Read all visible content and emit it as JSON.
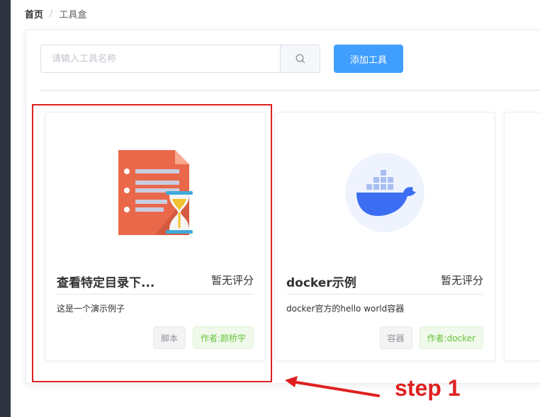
{
  "breadcrumb": {
    "home": "首页",
    "separator": "/",
    "current": "工具盒"
  },
  "search": {
    "placeholder": "请输入工具名称",
    "value": ""
  },
  "add_button": "添加工具",
  "cards": [
    {
      "title": "查看特定目录下...",
      "rating": "暂无评分",
      "description": "这是一个演示例子",
      "tags": [
        "脚本",
        "作者:颜桥宇"
      ],
      "icon": "document-hourglass-icon"
    },
    {
      "title": "docker示例",
      "rating": "暂无评分",
      "description": "docker官方的hello world容器",
      "tags": [
        "容器",
        "作者:docker"
      ],
      "icon": "docker-whale-icon"
    }
  ],
  "annotation": {
    "label": "step 1",
    "color": "#e02020"
  },
  "colors": {
    "primary": "#409eff",
    "success": "#67c23a",
    "sidebar": "#2f3440"
  }
}
